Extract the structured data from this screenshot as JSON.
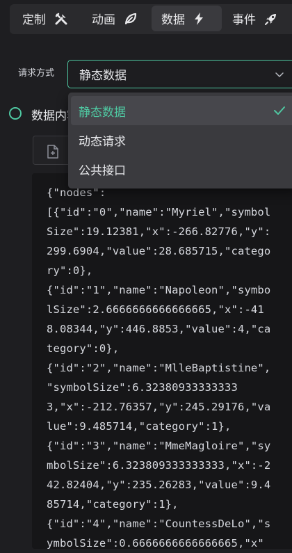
{
  "tabs": [
    {
      "label": "定制",
      "icon": "tools-icon"
    },
    {
      "label": "动画",
      "icon": "leaf-icon"
    },
    {
      "label": "数据",
      "icon": "bolt-icon",
      "active": true
    },
    {
      "label": "事件",
      "icon": "rocket-icon"
    }
  ],
  "request": {
    "label": "请求方式",
    "value": "静态数据",
    "options": [
      {
        "label": "静态数据",
        "selected": true
      },
      {
        "label": "动态请求",
        "selected": false
      },
      {
        "label": "公共接口",
        "selected": false
      }
    ]
  },
  "content": {
    "title": "数据内容",
    "code": "{\"nodes\":\n[{\"id\":\"0\",\"name\":\"Myriel\",\"symbolSize\":19.12381,\"x\":-266.82776,\"y\":299.6904,\"value\":28.685715,\"category\":0},\n{\"id\":\"1\",\"name\":\"Napoleon\",\"symbolSize\":2.6666666666666665,\"x\":-418.08344,\"y\":446.8853,\"value\":4,\"category\":0},\n{\"id\":\"2\",\"name\":\"MlleBaptistine\",\n\"symbolSize\":6.323809333333333,\"x\":-212.76357,\"y\":245.29176,\"value\":9.485714,\"category\":1},\n{\"id\":\"3\",\"name\":\"MmeMagloire\",\"symbolSize\":6.323809333333333,\"x\":-242.82404,\"y\":235.26283,\"value\":9.485714,\"category\":1},\n{\"id\":\"4\",\"name\":\"CountessDeLo\",\"symbolSize\":0.6666666666666665,\"x\""
  },
  "colors": {
    "accent": "#4fc8a2",
    "background": "#1e1e21",
    "panel": "#2a2a2d",
    "code_bg": "#161618"
  }
}
